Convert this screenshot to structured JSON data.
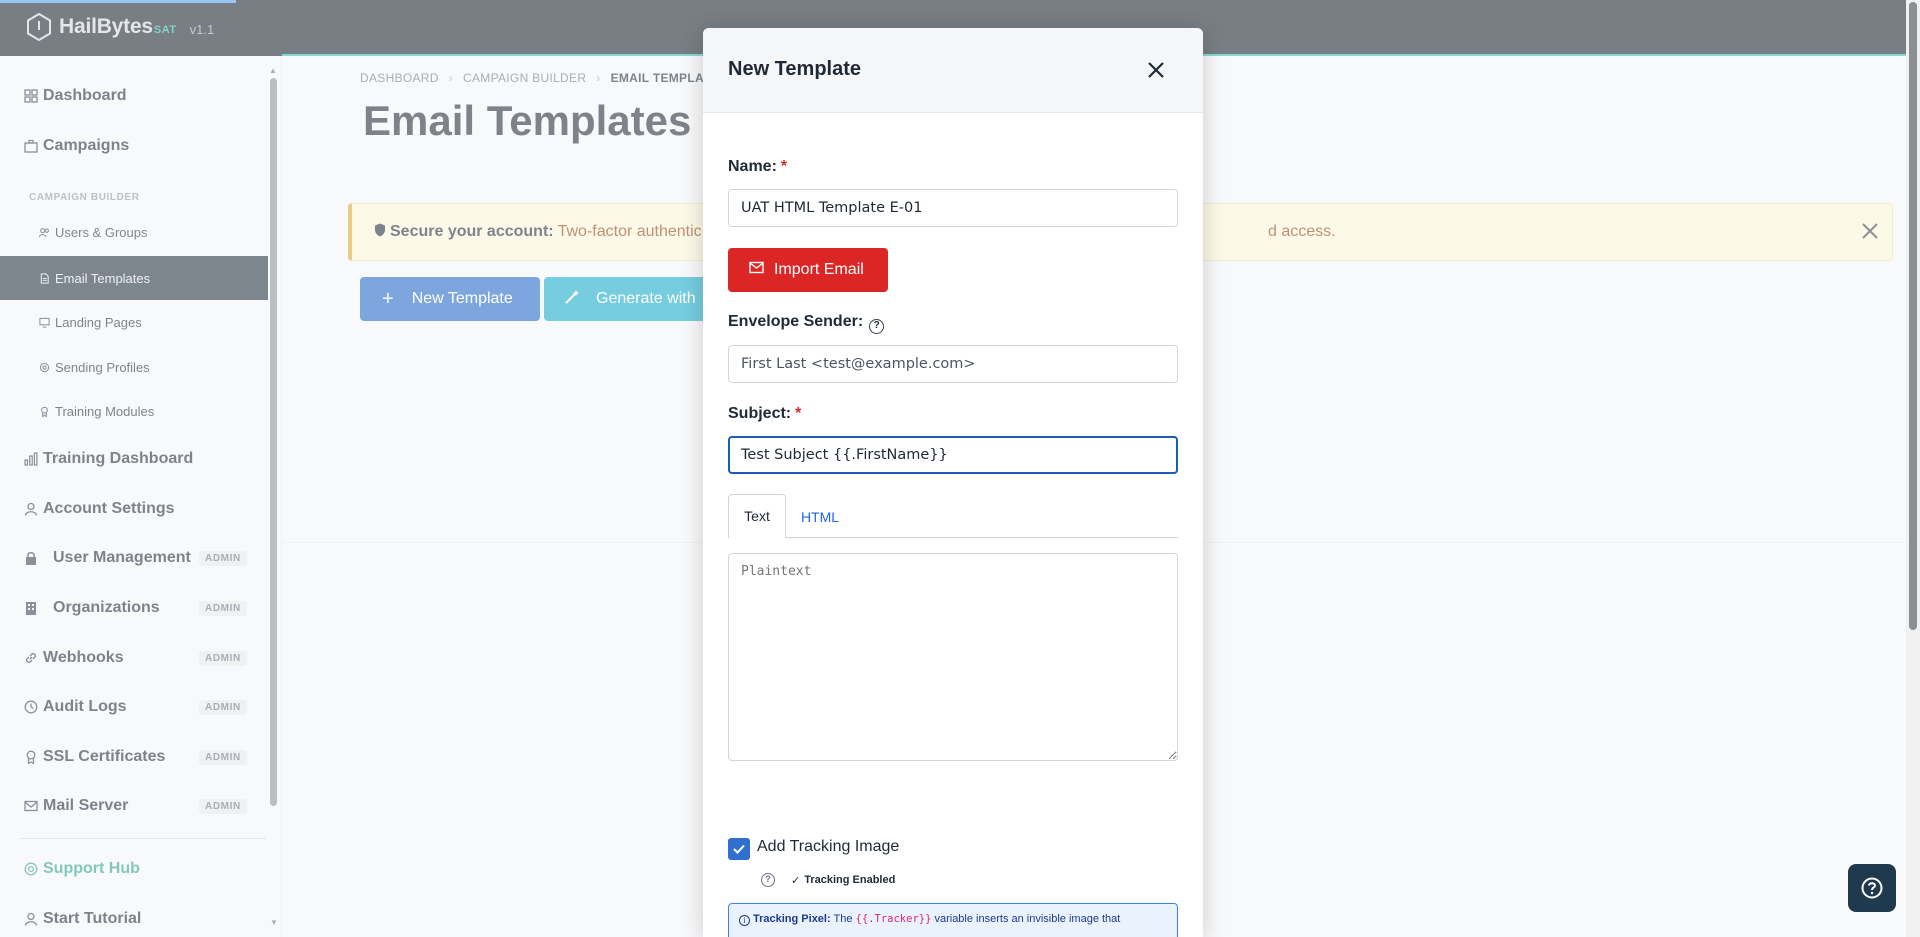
{
  "app": {
    "brand_name": "HailBytes",
    "brand_suffix": "SAT",
    "version": "v1.1"
  },
  "sidebar": {
    "section_label": "CAMPAIGN BUILDER",
    "items": [
      {
        "label": "Dashboard",
        "icon": "grid-icon"
      },
      {
        "label": "Campaigns",
        "icon": "briefcase-icon"
      },
      {
        "label": "Users & Groups",
        "icon": "users-icon"
      },
      {
        "label": "Email Templates",
        "icon": "file-icon"
      },
      {
        "label": "Landing Pages",
        "icon": "monitor-icon"
      },
      {
        "label": "Sending Profiles",
        "icon": "gear-icon"
      },
      {
        "label": "Training Modules",
        "icon": "award-icon"
      },
      {
        "label": "Training Dashboard",
        "icon": "bar-chart-icon"
      },
      {
        "label": "Account Settings",
        "icon": "user-icon"
      },
      {
        "label": "User Management",
        "icon": "lock-icon",
        "badge": "ADMIN"
      },
      {
        "label": "Organizations",
        "icon": "building-icon",
        "badge": "ADMIN"
      },
      {
        "label": "Webhooks",
        "icon": "link-icon",
        "badge": "ADMIN"
      },
      {
        "label": "Audit Logs",
        "icon": "clock-icon",
        "badge": "ADMIN"
      },
      {
        "label": "SSL Certificates",
        "icon": "certificate-icon",
        "badge": "ADMIN"
      },
      {
        "label": "Mail Server",
        "icon": "mail-icon",
        "badge": "ADMIN"
      },
      {
        "label": "Support Hub",
        "icon": "lifebuoy-icon"
      },
      {
        "label": "Start Tutorial",
        "icon": "person-icon"
      }
    ]
  },
  "main": {
    "breadcrumb": [
      "DASHBOARD",
      "CAMPAIGN BUILDER",
      "EMAIL TEMPLATES"
    ],
    "title": "Email Templates",
    "alert": {
      "strong": "Secure your account:",
      "text_visible_left": "Two-factor authentic",
      "text_visible_right": "d access."
    },
    "new_template_button": "New Template",
    "generate_button": "Generate with"
  },
  "modal": {
    "title": "New Template",
    "name_label": "Name:",
    "required_mark": "*",
    "name_value": "UAT HTML Template E-01",
    "import_button": "Import Email",
    "envelope_label": "Envelope Sender:",
    "envelope_placeholder": "First Last <test@example.com>",
    "subject_label": "Subject:",
    "subject_value": "Test Subject {{.FirstName}}",
    "tabs": [
      "Text",
      "HTML"
    ],
    "plaintext_placeholder": "Plaintext",
    "tracking_checkbox_label": "Add Tracking Image",
    "tracking_status": "Tracking Enabled",
    "info": {
      "strong": "Tracking Pixel:",
      "text_before": "The",
      "code": "{{.Tracker}}",
      "text_after": "variable inserts an invisible image that"
    }
  },
  "colors": {
    "topbar": "#16222c",
    "primary": "#2266c7",
    "danger": "#dc2626",
    "teal": "#14a9c8",
    "active_nav": "#1f2f3a"
  }
}
